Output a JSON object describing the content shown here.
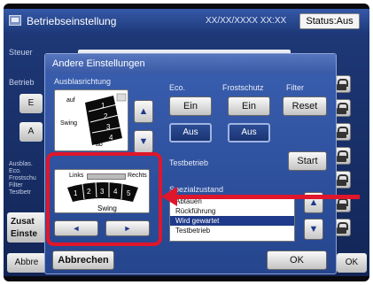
{
  "main": {
    "title": "Betriebseinstellung",
    "datetime": "XX/XX/XXXX XX:XX",
    "status": "Status:Aus",
    "bg_labels": [
      "Steuer",
      "Betrieb",
      "Ausblas.",
      "Eco.",
      "Frostschu",
      "Filter",
      "Testbetr"
    ],
    "bg_buttons": [
      "E",
      "A",
      "Zusat",
      "Einste"
    ],
    "cancel_partial": "Abbre",
    "ok_partial": "OK"
  },
  "dialog": {
    "title": "Andere Einstellungen",
    "ausblasrichtung": {
      "label": "Ausblasrichtung",
      "auf": "auf",
      "ab": "ab",
      "swing": "Swing",
      "steps": [
        "1",
        "2",
        "3",
        "4"
      ]
    },
    "eco": {
      "label": "Eco.",
      "ein": "Ein",
      "aus": "Aus"
    },
    "frostschutz": {
      "label": "Frostschutz",
      "ein": "Ein",
      "aus": "Aus"
    },
    "filter": {
      "label": "Filter",
      "reset": "Reset"
    },
    "testbetrieb": {
      "label": "Testbetrieb",
      "start": "Start"
    },
    "horizontal": {
      "links": "Links",
      "rechts": "Rechts",
      "swing": "Swing",
      "steps": [
        "1",
        "2",
        "3",
        "4",
        "5"
      ]
    },
    "spezialzustand": {
      "label": "Spezialzustand",
      "items": [
        "Abtauen",
        "Rückführung",
        "Wird gewartet",
        "Testbetrieb"
      ]
    },
    "cancel": "Abbrechen",
    "ok": "OK"
  },
  "colors": {
    "highlight": "#e0162b",
    "selected_dark": "#1f3a8a"
  }
}
